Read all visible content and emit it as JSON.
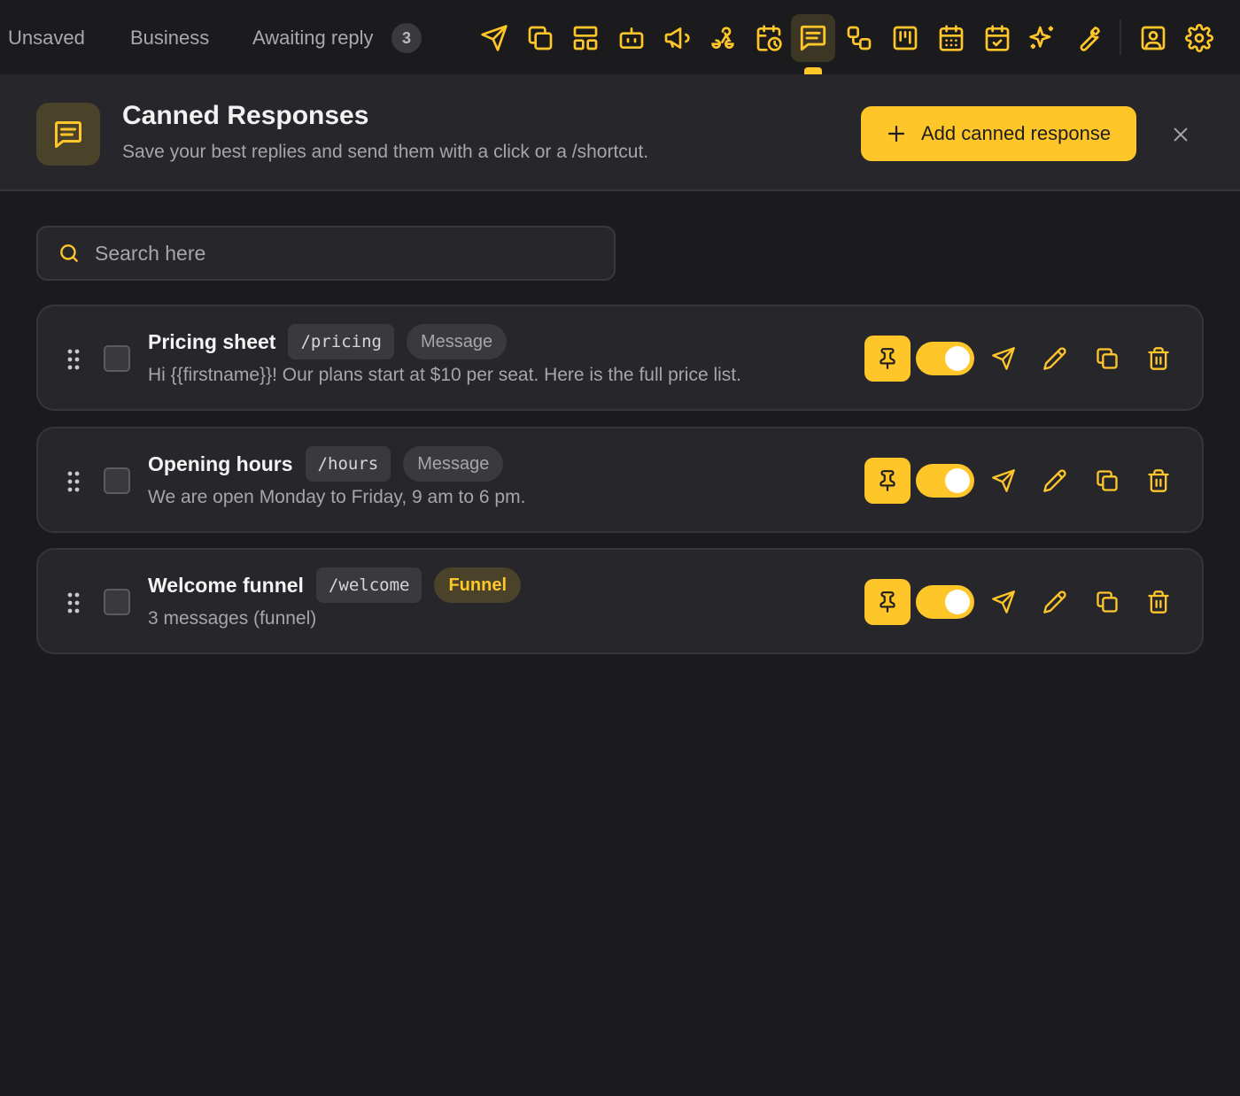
{
  "topbar": {
    "filters": [
      {
        "label": "Unsaved"
      },
      {
        "label": "Business"
      },
      {
        "label": "Awaiting reply",
        "count": "3"
      }
    ],
    "tools": [
      {
        "icon": "send-icon"
      },
      {
        "icon": "copy-icon"
      },
      {
        "icon": "layout-icon"
      },
      {
        "icon": "robot-icon"
      },
      {
        "icon": "megaphone-icon"
      },
      {
        "icon": "webhook-icon"
      },
      {
        "icon": "calendar-clock-icon"
      },
      {
        "icon": "message-square-icon",
        "active": true
      },
      {
        "icon": "workflow-icon"
      },
      {
        "icon": "kanban-icon"
      },
      {
        "icon": "calendar-grid-icon"
      },
      {
        "icon": "calendar-check-icon"
      },
      {
        "icon": "sparkles-icon"
      },
      {
        "icon": "wrench-icon"
      },
      {
        "icon": "contact-icon"
      },
      {
        "icon": "settings-icon"
      }
    ]
  },
  "header": {
    "icon": "message-square-icon",
    "title": "Canned Responses",
    "subtitle": "Save your best replies and send them with a click or a /shortcut.",
    "add_label": "Add canned response"
  },
  "search": {
    "placeholder": "Search here"
  },
  "responses": [
    {
      "title": "Pricing sheet",
      "shortcut": "/pricing",
      "type": "Message",
      "preview": "Hi {{firstname}}! Our plans start at $10 per seat. Here is the full price list.",
      "pinned": true,
      "enabled": true
    },
    {
      "title": "Opening hours",
      "shortcut": "/hours",
      "type": "Message",
      "preview": "We are open Monday to Friday, 9 am to 6 pm.",
      "pinned": true,
      "enabled": true
    },
    {
      "title": "Welcome funnel",
      "shortcut": "/welcome",
      "type": "Funnel",
      "preview": "3 messages (funnel)",
      "pinned": true,
      "enabled": true
    }
  ],
  "colors": {
    "accent": "#ffc62a",
    "background": "#1b1b1d",
    "panel": "#27272b"
  }
}
